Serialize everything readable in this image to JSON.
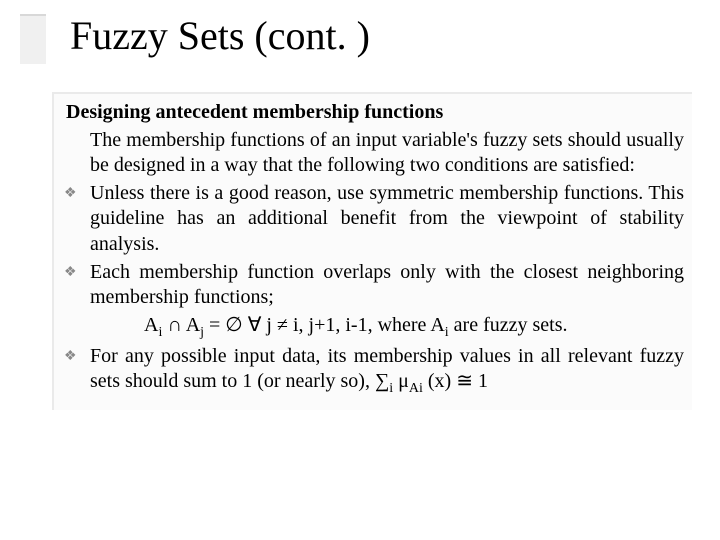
{
  "title": "Fuzzy Sets (cont. )",
  "heading": "Designing antecedent membership functions",
  "intro": "The membership functions of an input variable's fuzzy sets should usually be designed  in a way that the following two conditions are satisfied:",
  "bullets": {
    "b1": "Unless there is a good reason, use symmetric membership functions. This guideline has an additional benefit from the viewpoint of stability analysis.",
    "b2": "Each membership function overlaps only with the closest neighboring membership functions;",
    "b3_pre": "For any possible input data, its membership values in all relevant fuzzy sets should sum to 1 (or nearly so),  "
  },
  "formula": {
    "lhs_a": "A",
    "sub_i": "i",
    "cap": " ∩ ",
    "sub_j": "j",
    "eq_empty": " = ∅   ",
    "forall": "∀",
    "neq": " j ≠ i, j+1, i-1, where A",
    "tail": " are fuzzy sets."
  },
  "sum": {
    "sigma": "∑",
    "sub_i2": "i",
    "mu": " μ",
    "sub_ai": "Ai",
    "x": " (x) ",
    "approx": "≅",
    "one": " 1"
  },
  "bullet_char": "❖"
}
